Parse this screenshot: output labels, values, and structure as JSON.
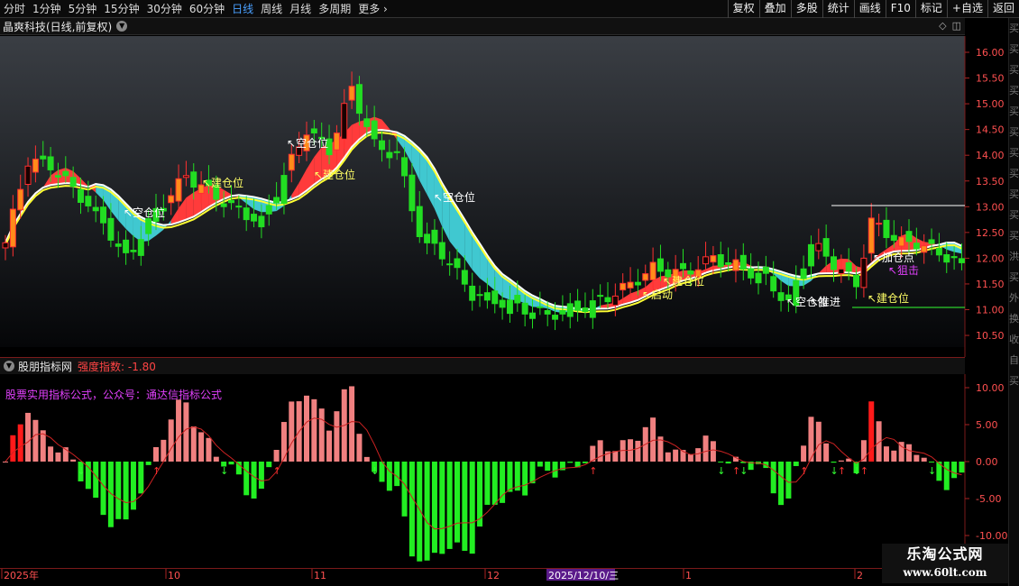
{
  "toolbar": {
    "periods": [
      "分时",
      "1分钟",
      "5分钟",
      "15分钟",
      "30分钟",
      "60分钟",
      "日线",
      "周线",
      "月线",
      "多周期",
      "更多"
    ],
    "active_period": "日线",
    "right_buttons": [
      "复权",
      "叠加",
      "多股",
      "统计",
      "画线",
      "F10",
      "标记",
      "+自选",
      "返回"
    ]
  },
  "stock": {
    "title": "晶爽科技(日线,前复权)"
  },
  "indicator": {
    "name": "股朋指标网",
    "value_label": "强度指数: -1.80",
    "watermark": "股票实用指标公式，公众号：通达信指标公式"
  },
  "price_axis": [
    "16.00",
    "15.50",
    "15.00",
    "14.50",
    "14.00",
    "13.50",
    "13.00",
    "12.50",
    "12.00",
    "11.50",
    "11.00",
    "10.50"
  ],
  "osc_axis": [
    "10.00",
    "5.00",
    "0.00",
    "-5.00",
    "-10.00"
  ],
  "time_axis": {
    "labels": [
      "2025年",
      "10",
      "11",
      "12",
      "1",
      "2"
    ],
    "highlight": "2025/12/10/三"
  },
  "annotations": [
    "建仓位",
    "空仓位",
    "空仓位",
    "建仓位",
    "空仓位",
    "启动",
    "建仓位",
    "空仓位",
    "推进",
    "加仓点",
    "狙击",
    "建仓位"
  ],
  "right_strip_chars": [
    "买",
    "买",
    "买",
    "买",
    "买",
    "买",
    "买",
    "买",
    "买",
    "买",
    "买",
    "洪",
    "买",
    "外",
    "换",
    "收",
    "自",
    "买"
  ],
  "logo": {
    "line1": "乐淘公式网",
    "line2": "www.60lt.com"
  },
  "colors": {
    "up": "#ff8c1a",
    "up_dark": "#1a0000",
    "down": "#22dd22",
    "ribbon_up": "#ff3b3b",
    "ribbon_down": "#40c8d0",
    "hist_pos": "#f08080",
    "hist_neg": "#22ee22",
    "accent": "#4aa0ff"
  }
}
